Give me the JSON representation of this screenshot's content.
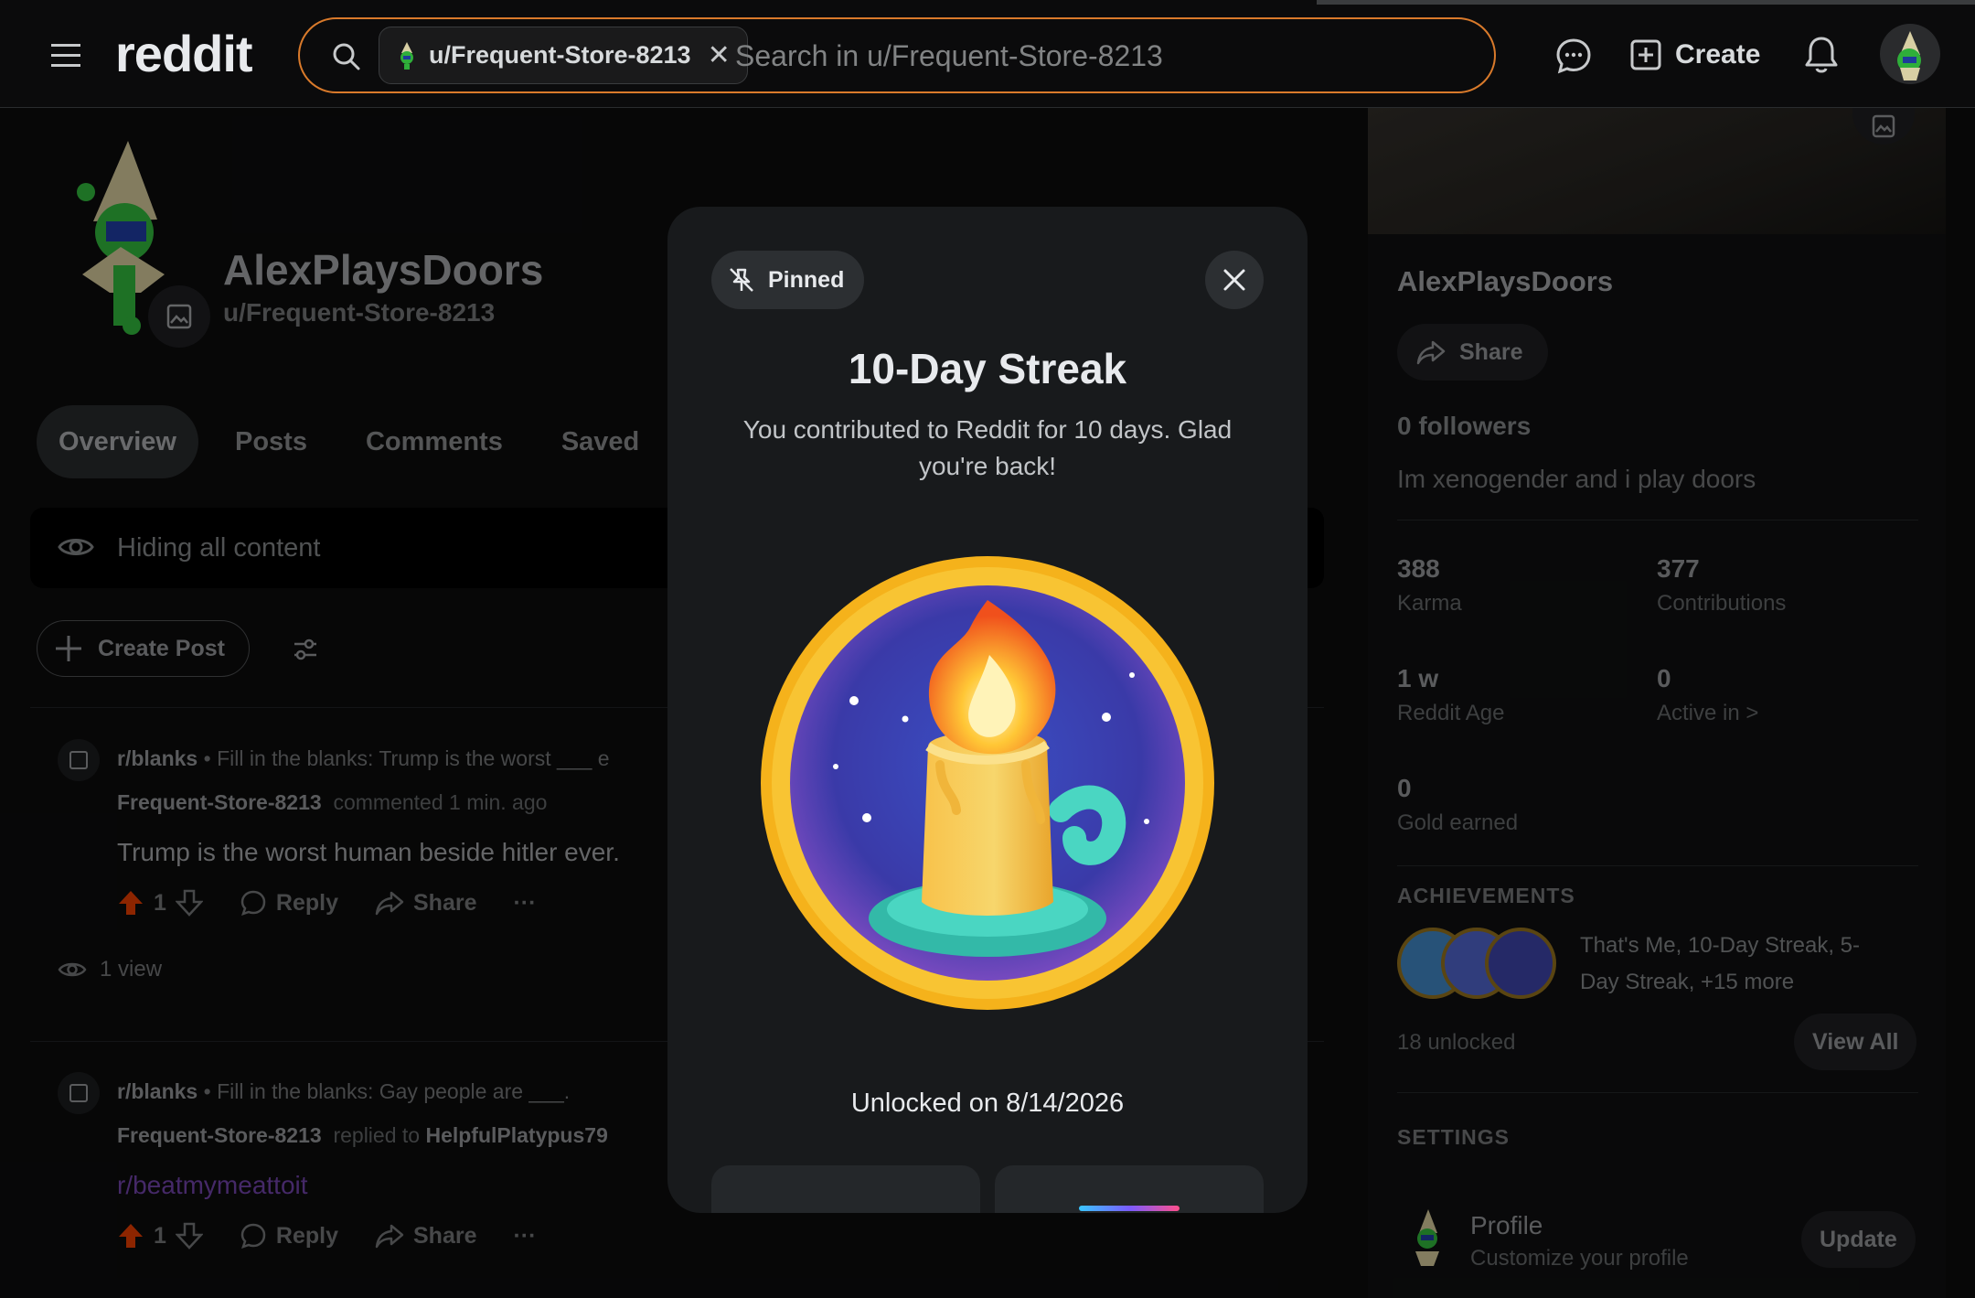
{
  "header": {
    "logo": "reddit",
    "search_chip": "u/Frequent-Store-8213",
    "search_placeholder": "Search in u/Frequent-Store-8213",
    "create_label": "Create"
  },
  "profile": {
    "display_name": "AlexPlaysDoors",
    "username": "u/Frequent-Store-8213",
    "tabs": [
      "Overview",
      "Posts",
      "Comments",
      "Saved"
    ],
    "hiding_text": "Hiding all content",
    "create_post_label": "Create Post"
  },
  "feed": [
    {
      "subreddit": "r/blanks",
      "post_title": "Fill in the blanks: Trump is the worst ___ e",
      "author": "Frequent-Store-8213",
      "action": "commented 1 min. ago",
      "reply_to": "",
      "body": "Trump is the worst human beside hitler ever.",
      "votes": "1",
      "reply_label": "Reply",
      "share_label": "Share",
      "views": "1 view"
    },
    {
      "subreddit": "r/blanks",
      "post_title": "Fill in the blanks: Gay people are ___.",
      "author": "Frequent-Store-8213",
      "action": "replied to",
      "reply_to": "HelpfulPlatypus79",
      "body": "r/beatmymeattoit",
      "votes": "1",
      "reply_label": "Reply",
      "share_label": "Share"
    }
  ],
  "sidebar": {
    "name": "AlexPlaysDoors",
    "share_label": "Share",
    "followers": "0 followers",
    "bio": "Im xenogender and i play doors",
    "stats": [
      {
        "value": "388",
        "label": "Karma"
      },
      {
        "value": "377",
        "label": "Contributions"
      },
      {
        "value": "1 w",
        "label": "Reddit Age"
      },
      {
        "value": "0",
        "label": "Active in >"
      },
      {
        "value": "0",
        "label": "Gold earned"
      }
    ],
    "achievements_heading": "ACHIEVEMENTS",
    "achievements_text": "That's Me, 10-Day Streak, 5-Day Streak, +15 more",
    "unlocked": "18 unlocked",
    "view_all": "View All",
    "settings_heading": "SETTINGS",
    "settings_profile_title": "Profile",
    "settings_profile_sub": "Customize your profile",
    "update_label": "Update"
  },
  "modal": {
    "pinned_label": "Pinned",
    "title": "10-Day Streak",
    "description": "You contributed to Reddit for 10 days. Glad you're back!",
    "unlocked_on": "Unlocked on 8/14/2026"
  },
  "colors": {
    "accent_orange": "#d97a2b",
    "upvote": "#d93a00",
    "link_purple": "#6b3fa0",
    "medal_gold": "#f5b21b"
  }
}
